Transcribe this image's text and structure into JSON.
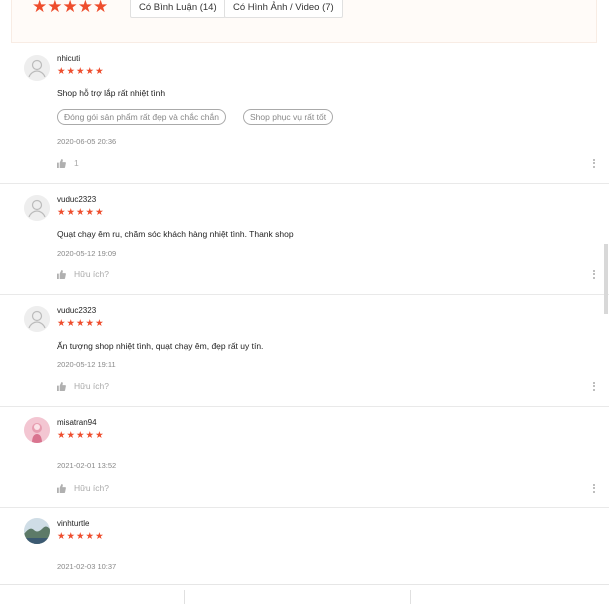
{
  "summary": {
    "stars": "★★★★★",
    "filters": [
      "Có Bình Luận (14)",
      "Có Hình Ảnh / Video (7)"
    ]
  },
  "reviews": [
    {
      "username": "nhicuti",
      "stars": "★★★★★",
      "comment": "Shop hỗ trợ lắp rất nhiệt tình",
      "tags": [
        "Đóng gói sản phẩm rất đẹp và chắc chắn",
        "Shop phục vụ rất tốt"
      ],
      "date": "2020-06-05 20:36",
      "like_label": "1"
    },
    {
      "username": "vuduc2323",
      "stars": "★★★★★",
      "comment": "Quạt chạy êm ru, chăm sóc khách hàng nhiệt tình. Thank shop",
      "date": "2020-05-12 19:09",
      "like_label": "Hữu ích?"
    },
    {
      "username": "vuduc2323",
      "stars": "★★★★★",
      "comment": "Ấn tượng shop nhiệt tình, quạt chạy êm, đẹp rất uy tín.",
      "date": "2020-05-12 19:11",
      "like_label": "Hữu ích?"
    },
    {
      "username": "misatran94",
      "stars": "★★★★★",
      "date": "2021-02-01 13:52",
      "like_label": "Hữu ích?"
    },
    {
      "username": "vinhturtle",
      "stars": "★★★★★",
      "date": "2021-02-03 10:37"
    }
  ],
  "colors": {
    "accent": "#ee4d2d",
    "panel_bg": "#fffbf8"
  },
  "icons": {
    "like": "thumbs-up-icon",
    "more": "more-vertical-icon",
    "avatar_default": "user-silhouette-icon"
  }
}
